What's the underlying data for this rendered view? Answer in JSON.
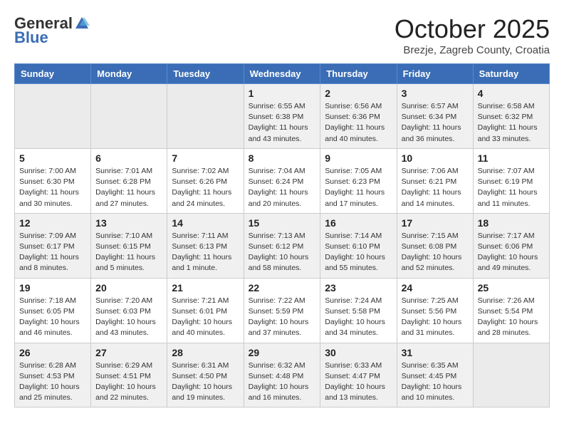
{
  "header": {
    "logo_general": "General",
    "logo_blue": "Blue",
    "month_title": "October 2025",
    "location": "Brezje, Zagreb County, Croatia"
  },
  "weekdays": [
    "Sunday",
    "Monday",
    "Tuesday",
    "Wednesday",
    "Thursday",
    "Friday",
    "Saturday"
  ],
  "weeks": [
    [
      {
        "num": "",
        "info": ""
      },
      {
        "num": "",
        "info": ""
      },
      {
        "num": "",
        "info": ""
      },
      {
        "num": "1",
        "info": "Sunrise: 6:55 AM\nSunset: 6:38 PM\nDaylight: 11 hours\nand 43 minutes."
      },
      {
        "num": "2",
        "info": "Sunrise: 6:56 AM\nSunset: 6:36 PM\nDaylight: 11 hours\nand 40 minutes."
      },
      {
        "num": "3",
        "info": "Sunrise: 6:57 AM\nSunset: 6:34 PM\nDaylight: 11 hours\nand 36 minutes."
      },
      {
        "num": "4",
        "info": "Sunrise: 6:58 AM\nSunset: 6:32 PM\nDaylight: 11 hours\nand 33 minutes."
      }
    ],
    [
      {
        "num": "5",
        "info": "Sunrise: 7:00 AM\nSunset: 6:30 PM\nDaylight: 11 hours\nand 30 minutes."
      },
      {
        "num": "6",
        "info": "Sunrise: 7:01 AM\nSunset: 6:28 PM\nDaylight: 11 hours\nand 27 minutes."
      },
      {
        "num": "7",
        "info": "Sunrise: 7:02 AM\nSunset: 6:26 PM\nDaylight: 11 hours\nand 24 minutes."
      },
      {
        "num": "8",
        "info": "Sunrise: 7:04 AM\nSunset: 6:24 PM\nDaylight: 11 hours\nand 20 minutes."
      },
      {
        "num": "9",
        "info": "Sunrise: 7:05 AM\nSunset: 6:23 PM\nDaylight: 11 hours\nand 17 minutes."
      },
      {
        "num": "10",
        "info": "Sunrise: 7:06 AM\nSunset: 6:21 PM\nDaylight: 11 hours\nand 14 minutes."
      },
      {
        "num": "11",
        "info": "Sunrise: 7:07 AM\nSunset: 6:19 PM\nDaylight: 11 hours\nand 11 minutes."
      }
    ],
    [
      {
        "num": "12",
        "info": "Sunrise: 7:09 AM\nSunset: 6:17 PM\nDaylight: 11 hours\nand 8 minutes."
      },
      {
        "num": "13",
        "info": "Sunrise: 7:10 AM\nSunset: 6:15 PM\nDaylight: 11 hours\nand 5 minutes."
      },
      {
        "num": "14",
        "info": "Sunrise: 7:11 AM\nSunset: 6:13 PM\nDaylight: 11 hours\nand 1 minute."
      },
      {
        "num": "15",
        "info": "Sunrise: 7:13 AM\nSunset: 6:12 PM\nDaylight: 10 hours\nand 58 minutes."
      },
      {
        "num": "16",
        "info": "Sunrise: 7:14 AM\nSunset: 6:10 PM\nDaylight: 10 hours\nand 55 minutes."
      },
      {
        "num": "17",
        "info": "Sunrise: 7:15 AM\nSunset: 6:08 PM\nDaylight: 10 hours\nand 52 minutes."
      },
      {
        "num": "18",
        "info": "Sunrise: 7:17 AM\nSunset: 6:06 PM\nDaylight: 10 hours\nand 49 minutes."
      }
    ],
    [
      {
        "num": "19",
        "info": "Sunrise: 7:18 AM\nSunset: 6:05 PM\nDaylight: 10 hours\nand 46 minutes."
      },
      {
        "num": "20",
        "info": "Sunrise: 7:20 AM\nSunset: 6:03 PM\nDaylight: 10 hours\nand 43 minutes."
      },
      {
        "num": "21",
        "info": "Sunrise: 7:21 AM\nSunset: 6:01 PM\nDaylight: 10 hours\nand 40 minutes."
      },
      {
        "num": "22",
        "info": "Sunrise: 7:22 AM\nSunset: 5:59 PM\nDaylight: 10 hours\nand 37 minutes."
      },
      {
        "num": "23",
        "info": "Sunrise: 7:24 AM\nSunset: 5:58 PM\nDaylight: 10 hours\nand 34 minutes."
      },
      {
        "num": "24",
        "info": "Sunrise: 7:25 AM\nSunset: 5:56 PM\nDaylight: 10 hours\nand 31 minutes."
      },
      {
        "num": "25",
        "info": "Sunrise: 7:26 AM\nSunset: 5:54 PM\nDaylight: 10 hours\nand 28 minutes."
      }
    ],
    [
      {
        "num": "26",
        "info": "Sunrise: 6:28 AM\nSunset: 4:53 PM\nDaylight: 10 hours\nand 25 minutes."
      },
      {
        "num": "27",
        "info": "Sunrise: 6:29 AM\nSunset: 4:51 PM\nDaylight: 10 hours\nand 22 minutes."
      },
      {
        "num": "28",
        "info": "Sunrise: 6:31 AM\nSunset: 4:50 PM\nDaylight: 10 hours\nand 19 minutes."
      },
      {
        "num": "29",
        "info": "Sunrise: 6:32 AM\nSunset: 4:48 PM\nDaylight: 10 hours\nand 16 minutes."
      },
      {
        "num": "30",
        "info": "Sunrise: 6:33 AM\nSunset: 4:47 PM\nDaylight: 10 hours\nand 13 minutes."
      },
      {
        "num": "31",
        "info": "Sunrise: 6:35 AM\nSunset: 4:45 PM\nDaylight: 10 hours\nand 10 minutes."
      },
      {
        "num": "",
        "info": ""
      }
    ]
  ]
}
